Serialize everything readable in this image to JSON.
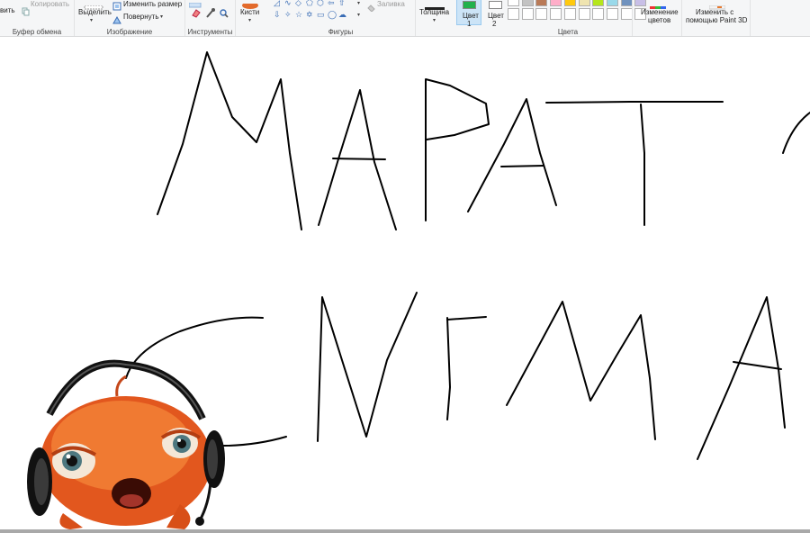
{
  "ribbon": {
    "clipboard": {
      "paste_label": "вить",
      "copy_label": "Копировать",
      "group_label": "Буфер обмена"
    },
    "image": {
      "select_label": "Выделить",
      "resize_label": "Изменить размер",
      "rotate_label": "Повернуть",
      "group_label": "Изображение"
    },
    "tools": {
      "group_label": "Инструменты"
    },
    "brushes": {
      "label": "Кисти"
    },
    "shapes": {
      "fill_label": "Заливка",
      "group_label": "Фигуры"
    },
    "size": {
      "label": "Толщина"
    },
    "colors": {
      "color1_label": "Цвет\n1",
      "color1_line1": "Цвет",
      "color1_line2": "1",
      "color2_line1": "Цвет",
      "color2_line2": "2",
      "edit_colors_line1": "Изменение",
      "edit_colors_line2": "цветов",
      "paint3d_line1": "Изменить с",
      "paint3d_line2": "помощью Paint 3D",
      "group_label": "Цвета",
      "color1_value": "#22b14c",
      "color2_value": "#ffffff",
      "palette_row1": [
        "#ffffff",
        "#c3c3c3",
        "#b97a57",
        "#ffaec9",
        "#ffc90e",
        "#efe4b0",
        "#b5e61d",
        "#99d9ea",
        "#7092be",
        "#c8bfe7"
      ],
      "palette_row2": [
        "#ffffff",
        "#ffffff",
        "#ffffff",
        "#ffffff",
        "#ffffff",
        "#ffffff",
        "#ffffff",
        "#ffffff",
        "#ffffff",
        "#ffffff"
      ]
    }
  },
  "canvas": {
    "background": "#ffffff",
    "ink_color": "#000000",
    "drawing_words": [
      "МАРАТ",
      "СИГМА"
    ],
    "mascot": "headphones-fish-character"
  }
}
